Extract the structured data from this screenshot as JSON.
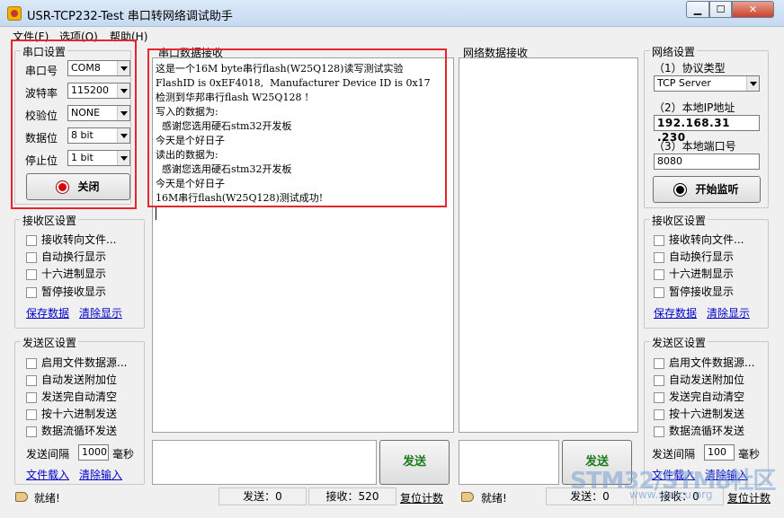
{
  "window": {
    "title": "USR-TCP232-Test 串口转网络调试助手",
    "min": "▁",
    "max": "☐",
    "close": "✕"
  },
  "menu": [
    "文件(F)",
    "选项(O)",
    "帮助(H)"
  ],
  "serial_settings": {
    "title": "串口设置",
    "rows": [
      {
        "label": "串口号",
        "value": "COM8"
      },
      {
        "label": "波特率",
        "value": "115200"
      },
      {
        "label": "校验位",
        "value": "NONE"
      },
      {
        "label": "数据位",
        "value": "8 bit"
      },
      {
        "label": "停止位",
        "value": "1 bit"
      }
    ],
    "button": "关闭"
  },
  "left_receive": {
    "title": "接收区设置",
    "options": [
      "接收转向文件...",
      "自动换行显示",
      "十六进制显示",
      "暂停接收显示"
    ],
    "save": "保存数据",
    "clear": "清除显示"
  },
  "left_send": {
    "title": "发送区设置",
    "options": [
      "启用文件数据源...",
      "自动发送附加位",
      "发送完自动清空",
      "按十六进制发送",
      "数据流循环发送"
    ],
    "interval_label": "发送间隔",
    "interval_value": "1000",
    "interval_unit": "毫秒",
    "load": "文件载入",
    "clear": "清除输入"
  },
  "serial_receive": {
    "title": "串口数据接收",
    "lines": [
      "这是一个16M byte串行flash(W25Q128)读写测试实验",
      "FlashID is 0xEF4018,  Manufacturer Device ID is 0x17",
      "检测到华邦串行flash W25Q128 !",
      "写入的数据为:",
      "  感谢您选用硬石stm32开发板",
      "今天是个好日子",
      "读出的数据为:",
      "  感谢您选用硬石stm32开发板",
      "今天是个好日子",
      "16M串行flash(W25Q128)测试成功!"
    ]
  },
  "network_receive": {
    "title": "网络数据接收"
  },
  "network_settings": {
    "title": "网络设置",
    "protocol_label": "（1）协议类型",
    "protocol_value": "TCP Server",
    "ip_label": "（2）本地IP地址",
    "ip_value": "192.168.31 .230",
    "port_label": "（3）本地端口号",
    "port_value": "8080",
    "button": "开始监听"
  },
  "right_receive": {
    "title": "接收区设置",
    "options": [
      "接收转向文件...",
      "自动换行显示",
      "十六进制显示",
      "暂停接收显示"
    ],
    "save": "保存数据",
    "clear": "清除显示"
  },
  "right_send": {
    "title": "发送区设置",
    "options": [
      "启用文件数据源...",
      "自动发送附加位",
      "发送完自动清空",
      "按十六进制发送",
      "数据流循环发送"
    ],
    "interval_label": "发送间隔",
    "interval_value": "100",
    "interval_unit": "毫秒",
    "load": "文件载入",
    "clear": "清除输入"
  },
  "send_button": "发送",
  "status_left": {
    "ready": "就绪!",
    "sent": "发送：0",
    "received": "接收：520",
    "reset": "复位计数"
  },
  "status_right": {
    "ready": "就绪!",
    "sent": "发送：0",
    "received": "接收：0",
    "reset": "复位计数"
  },
  "watermark": {
    "text": "STM32/STM8社区",
    "url": "www.stmcu.org"
  }
}
